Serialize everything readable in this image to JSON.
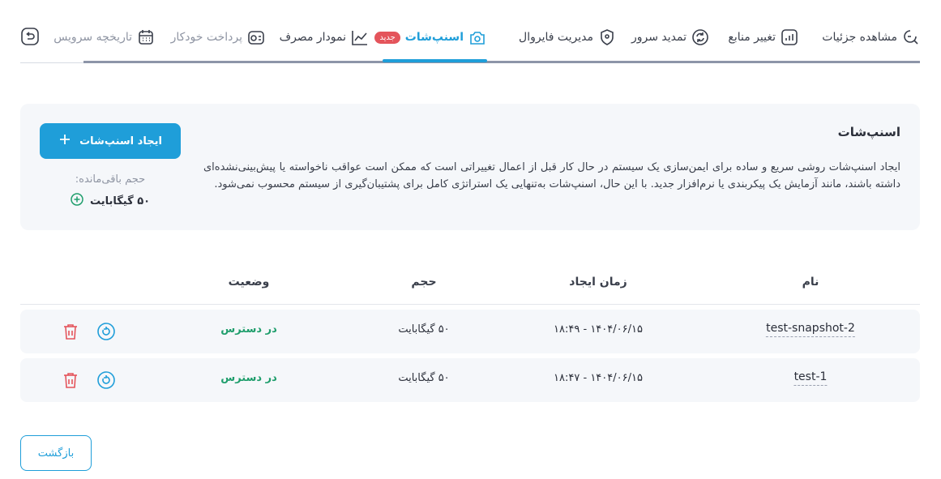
{
  "tabs": {
    "details": "مشاهده جزئیات",
    "resources": "تغییر منابع",
    "renew": "تمدید سرور",
    "firewall": "مدیریت فایروال",
    "snapshots": "اسنپ‌شات",
    "snapshots_badge": "جدید",
    "usage": "نمودار مصرف",
    "autopay": "پرداخت خودکار",
    "history": "تاریخچه سرویس"
  },
  "card": {
    "title": "اسنپ‌شات",
    "description": "ایجاد اسنپ‌شات روشی سریع و ساده برای ایمن‌سازی یک سیستم در حال کار قبل از اعمال تغییراتی است که ممکن است عواقب ناخواسته یا پیش‌بینی‌نشده‌ای داشته باشند، مانند آزمایش یک پیکربندی یا نرم‌افزار جدید. با این حال، اسنپ‌شات به‌تنهایی یک استراتژی کامل برای پشتیبان‌گیری از سیستم محسوب نمی‌شود.",
    "create_label": "ایجاد اسنپ‌شات",
    "remaining_label": "حجم باقی‌مانده:",
    "remaining_value": "۵۰ گیگابایت"
  },
  "table": {
    "headers": {
      "name": "نام",
      "created": "زمان ایجاد",
      "size": "حجم",
      "status": "وضعیت"
    },
    "rows": [
      {
        "name": "test-snapshot-2",
        "created": "۱۴۰۴/۰۶/۱۵ - ۱۸:۴۹",
        "size": "۵۰ گیگابایت",
        "status": "در دسترس"
      },
      {
        "name": "test-1",
        "created": "۱۴۰۴/۰۶/۱۵ - ۱۸:۴۷",
        "size": "۵۰ گیگابایت",
        "status": "در دسترس"
      }
    ]
  },
  "back_label": "بازگشت",
  "colors": {
    "accent": "#1f9ed9",
    "danger": "#e4545b",
    "success": "#1f9e6c"
  }
}
